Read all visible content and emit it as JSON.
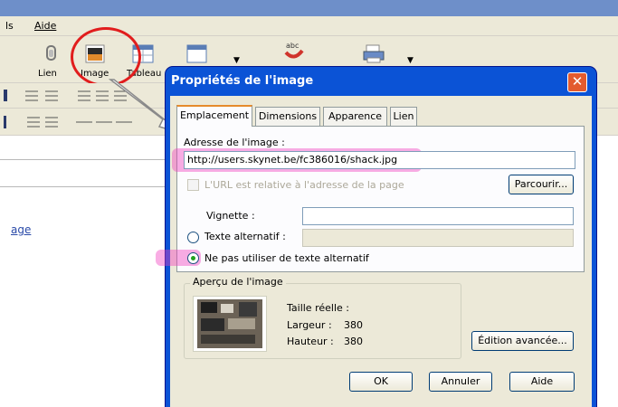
{
  "app": {
    "menu": [
      "ls",
      "Aide"
    ],
    "toolbar_labels": [
      "Lien",
      "Image",
      "Tableau"
    ],
    "editor_link": "age"
  },
  "dialog": {
    "title": "Propriétés de l'image",
    "close": "✕",
    "tabs": [
      "Emplacement",
      "Dimensions",
      "Apparence",
      "Lien"
    ],
    "address_label": "Adresse de l'image :",
    "address_value": "http://users.skynet.be/fc386016/shack.jpg",
    "relative_label": "L'URL est relative à l'adresse de la page",
    "browse_button": "Parcourir...",
    "thumbnail_label": "Vignette :",
    "alt_text_label": "Texte alternatif :",
    "no_alt_label": "Ne pas utiliser de texte alternatif",
    "preview_group": "Aperçu de l'image",
    "real_size": "Taille réelle :",
    "width_label": "Largeur :",
    "width_value": "380",
    "height_label": "Hauteur :",
    "height_value": "380",
    "advanced_button": "Édition avancée...",
    "ok_button": "OK",
    "cancel_button": "Annuler",
    "help_button": "Aide"
  },
  "colors": {
    "titlebar": "#0b53d6",
    "highlight": "#f03cbe",
    "annotation_circle": "#e11d1d"
  }
}
